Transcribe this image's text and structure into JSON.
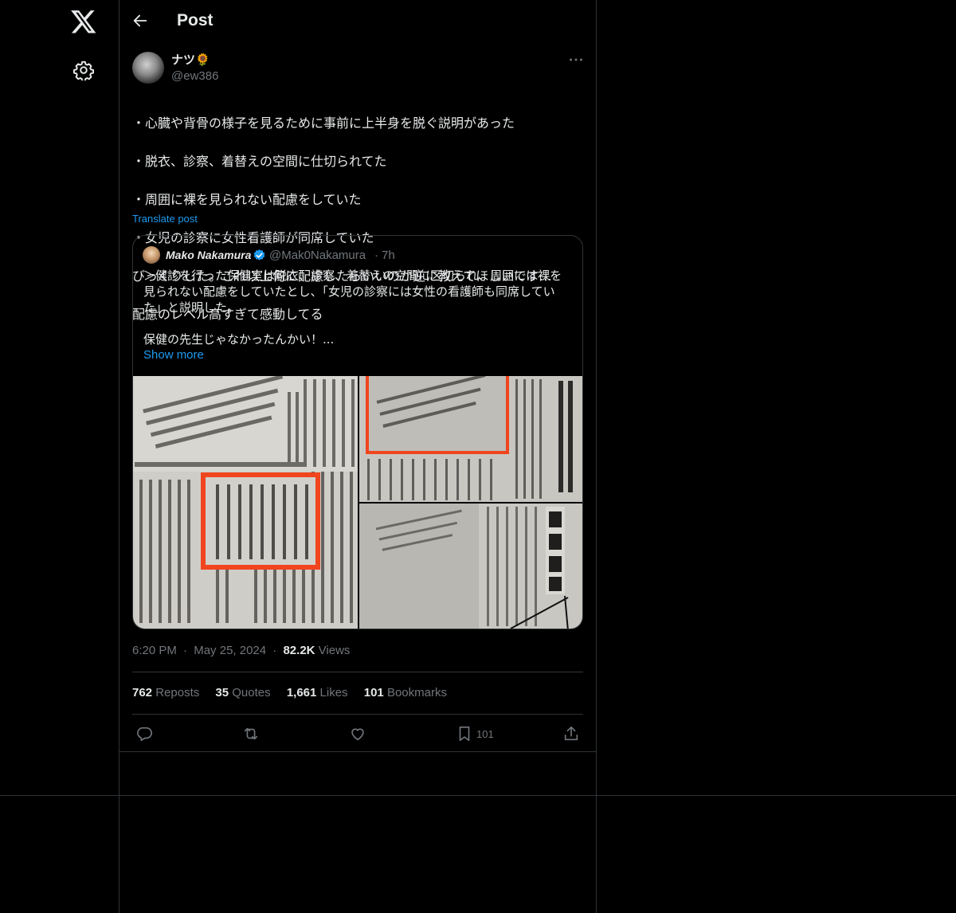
{
  "header": {
    "title": "Post"
  },
  "post": {
    "author_name": "ナツ🌻",
    "author_handle": "@ew386",
    "text_lines": [
      "・心臓や背骨の様子を見るために事前に上半身を脱ぐ説明があった",
      "・脱衣、診察、着替えの空間に仕切られてた",
      "・周囲に裸を見られない配慮をしていた",
      "・女児の診察に女性看護師が同席していた",
      "びっくりした。これ以上何に配慮したらいいのか逆に教えてほしいです…",
      "配慮のレベル高すぎて感動してる"
    ],
    "translate_label": "Translate post",
    "quote": {
      "name": "Mako Nakamura",
      "handle": "@Mak0Nakamura",
      "dot": "·",
      "time": "7h",
      "text": "＞健診を行った保健室は脱衣、診察、着替えの空間に区切られ、周囲には裸を見られない配慮をしていたとし、「女児の診察には女性の看護師も同席していた」と説明した。\n\n保健の先生じゃなかったんかい！...",
      "show_more": "Show more"
    },
    "meta": {
      "time": "6:20 PM",
      "sep1": "·",
      "date": "May 25, 2024",
      "sep2": "·",
      "views_count": "82.2K",
      "views_label": "Views"
    },
    "stats": {
      "reposts_count": "762",
      "reposts_label": "Reposts",
      "quotes_count": "35",
      "quotes_label": "Quotes",
      "likes_count": "1,661",
      "likes_label": "Likes",
      "bookmarks_count": "101",
      "bookmarks_label": "Bookmarks"
    },
    "actions": {
      "bookmark_count": "101"
    }
  },
  "colors": {
    "accent": "#1d9bf0",
    "muted": "#71767b",
    "border": "#2f3336"
  },
  "icons": [
    "x-logo-icon",
    "gear-icon",
    "back-arrow-icon",
    "more-icon",
    "verified-icon",
    "reply-icon",
    "repost-icon",
    "like-icon",
    "bookmark-icon",
    "share-icon"
  ]
}
